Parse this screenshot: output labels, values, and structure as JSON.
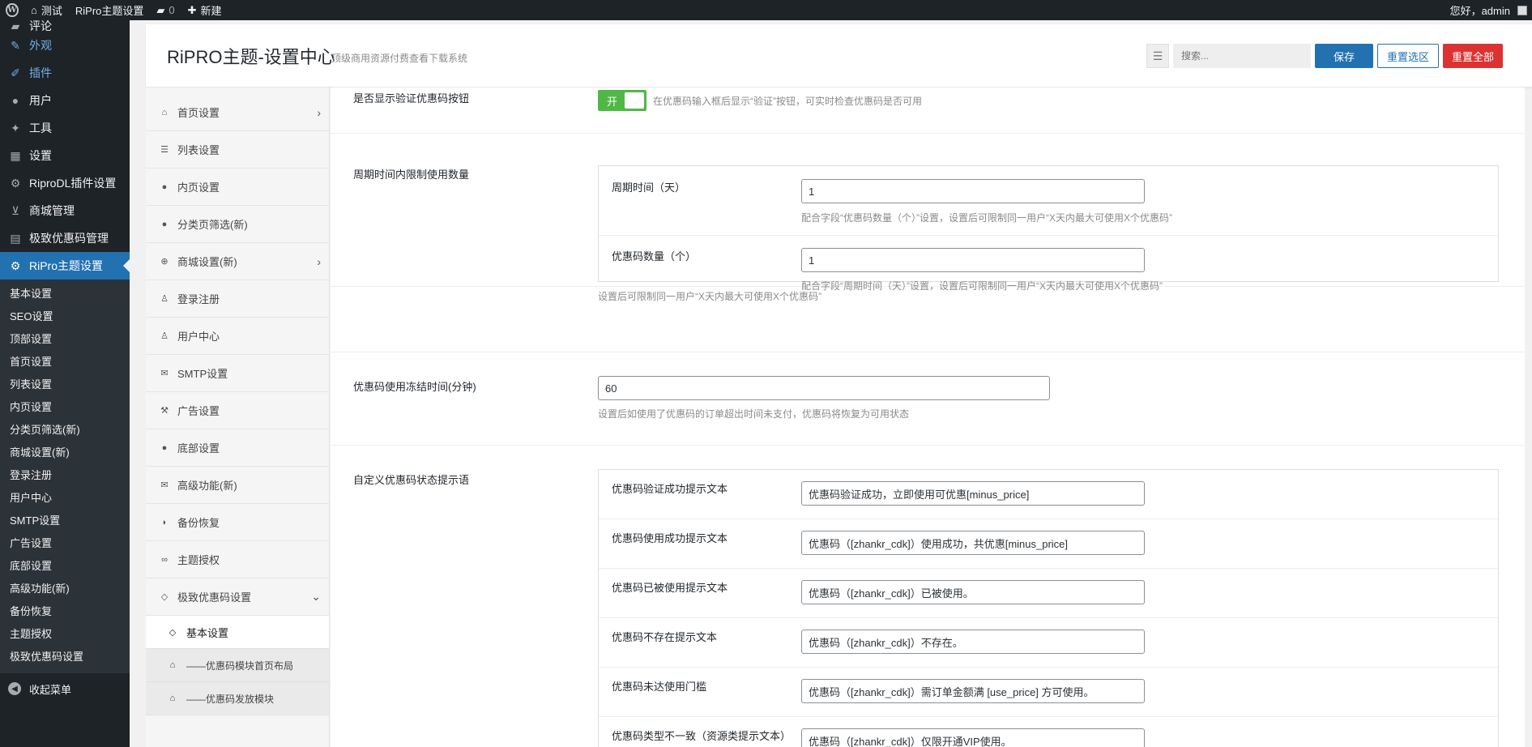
{
  "adminbar": {
    "site_name": "测试",
    "theme_settings": "RiPro主题设置",
    "comments_count": "0",
    "new_label": "新建",
    "greeting": "您好，admin"
  },
  "wp_menu": {
    "items": [
      {
        "label": "评论",
        "icon": "comment-icon"
      },
      {
        "label": "外观",
        "icon": "brush-icon"
      },
      {
        "label": "插件",
        "icon": "plugin-icon"
      },
      {
        "label": "用户",
        "icon": "user-icon"
      },
      {
        "label": "工具",
        "icon": "wrench-icon"
      },
      {
        "label": "设置",
        "icon": "settings-icon"
      },
      {
        "label": "RiproDL插件设置",
        "icon": "gear-icon"
      },
      {
        "label": "商城管理",
        "icon": "cart-icon"
      },
      {
        "label": "极致优惠码管理",
        "icon": "chart-icon"
      },
      {
        "label": "RiPro主题设置",
        "icon": "gear-icon"
      }
    ],
    "submenu": [
      "基本设置",
      "SEO设置",
      "顶部设置",
      "首页设置",
      "列表设置",
      "内页设置",
      "分类页筛选(新)",
      "商城设置(新)",
      "登录注册",
      "用户中心",
      "SMTP设置",
      "广告设置",
      "底部设置",
      "高级功能(新)",
      "备份恢复",
      "主题授权",
      "极致优惠码设置"
    ],
    "collapse": "收起菜单"
  },
  "header": {
    "title": "RiPRO主题-设置中心",
    "subtitle": "顶级商用资源付费查看下载系统",
    "search_placeholder": "搜索...",
    "save": "保存",
    "reset_section": "重置选区",
    "reset_all": "重置全部"
  },
  "nav": {
    "items": [
      {
        "label": "首页设置",
        "icon": "home-icon"
      },
      {
        "label": "列表设置",
        "icon": "list-icon"
      },
      {
        "label": "内页设置",
        "icon": "dot-icon"
      },
      {
        "label": "分类页筛选(新)",
        "icon": "dot-icon"
      },
      {
        "label": "商城设置(新)",
        "icon": "plus-circle-icon"
      },
      {
        "label": "登录注册",
        "icon": "user-outline-icon"
      },
      {
        "label": "用户中心",
        "icon": "user-outline-icon"
      },
      {
        "label": "SMTP设置",
        "icon": "envelope-icon"
      },
      {
        "label": "广告设置",
        "icon": "gavel-icon"
      },
      {
        "label": "底部设置",
        "icon": "dot-icon"
      },
      {
        "label": "高级功能(新)",
        "icon": "envelope-icon"
      },
      {
        "label": "备份恢复",
        "icon": "shield-icon"
      },
      {
        "label": "主题授权",
        "icon": "handshake-icon"
      },
      {
        "label": "极致优惠码设置",
        "icon": "diamond-icon"
      }
    ],
    "subs": [
      {
        "label": "基本设置",
        "icon": "diamond-icon"
      },
      {
        "label": "——优惠码模块首页布局",
        "icon": "home-icon"
      },
      {
        "label": "——优惠码发放模块",
        "icon": "home-icon"
      }
    ]
  },
  "fields": {
    "verify_button": {
      "title": "是否显示验证优惠码按钮",
      "switch_on": "开",
      "desc": "在优惠码输入框后显示“验证”按钮，可实时检查优惠码是否可用"
    },
    "period_limit": {
      "title": "周期时间内限制使用数量",
      "period_label": "周期时间（天）",
      "period_value": "1",
      "period_desc": "配合字段“优惠码数量（个）”设置，设置后可限制同一用户“X天内最大可使用X个优惠码”",
      "count_label": "优惠码数量（个）",
      "count_value": "1",
      "count_desc": "配合字段“周期时间（天）”设置，设置后可限制同一用户“X天内最大可使用X个优惠码”",
      "desc": "设置后可限制同一用户“X天内最大可使用X个优惠码”"
    },
    "freeze_time": {
      "title": "优惠码使用冻结时间(分钟)",
      "value": "60",
      "desc": "设置后如使用了优惠码的订单超出时间未支付，优惠码将恢复为可用状态"
    },
    "status_messages": {
      "title": "自定义优惠码状态提示语",
      "rows": [
        {
          "label": "优惠码验证成功提示文本",
          "value": "优惠码验证成功，立即使用可优惠[minus_price]"
        },
        {
          "label": "优惠码使用成功提示文本",
          "value": "优惠码（[zhankr_cdk]）使用成功，共优惠[minus_price]"
        },
        {
          "label": "优惠码已被使用提示文本",
          "value": "优惠码（[zhankr_cdk]）已被使用。"
        },
        {
          "label": "优惠码不存在提示文本",
          "value": "优惠码（[zhankr_cdk]）不存在。"
        },
        {
          "label": "优惠码未达使用门槛",
          "value": "优惠码（[zhankr_cdk]）需订单金额满 [use_price] 方可使用。"
        },
        {
          "label": "优惠码类型不一致（资源类提示文本）",
          "value": "优惠码（[zhankr_cdk]）仅限开通VIP使用。"
        }
      ]
    }
  }
}
